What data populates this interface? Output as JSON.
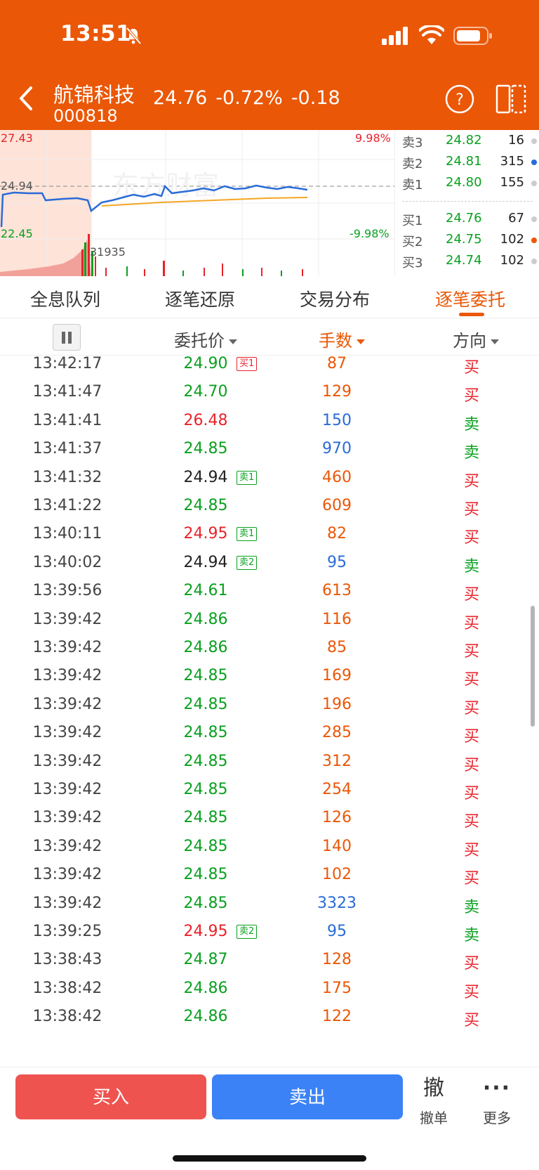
{
  "status": {
    "time": "13:51"
  },
  "stock": {
    "name": "航锦科技",
    "code": "000818",
    "price": "24.76",
    "change_pct": "-0.72%",
    "change": "-0.18"
  },
  "mini_chart": {
    "high_price": "27.43",
    "prev_close": "24.94",
    "low_price": "22.45",
    "high_pct": "9.98%",
    "low_pct": "-9.98%",
    "volume_label": "31935",
    "watermark": "东方财富"
  },
  "order_book": {
    "sell": [
      {
        "level": "卖3",
        "price": "24.82",
        "volume": "16",
        "dot_color": "#cccccc"
      },
      {
        "level": "卖2",
        "price": "24.81",
        "volume": "315",
        "dot_color": "#2a6bd8"
      },
      {
        "level": "卖1",
        "price": "24.80",
        "volume": "155",
        "dot_color": "#cccccc"
      }
    ],
    "buy": [
      {
        "level": "买1",
        "price": "24.76",
        "volume": "67",
        "dot_color": "#cccccc"
      },
      {
        "level": "买2",
        "price": "24.75",
        "volume": "102",
        "dot_color": "#ea5707"
      },
      {
        "level": "买3",
        "price": "24.74",
        "volume": "102",
        "dot_color": "#cccccc"
      }
    ]
  },
  "tabs": [
    {
      "label": "全息队列",
      "active": false
    },
    {
      "label": "逐笔还原",
      "active": false
    },
    {
      "label": "交易分布",
      "active": false
    },
    {
      "label": "逐笔委托",
      "active": true
    }
  ],
  "list_header": {
    "price": "委托价",
    "volume": "手数",
    "direction": "方向"
  },
  "colors": {
    "accent": "#ea5707",
    "up_red": "#e8232b",
    "down_green": "#0aa020",
    "neutral": "#222222",
    "vol_orange": "#ea5707",
    "vol_blue": "#2a6bd8"
  },
  "rows": [
    {
      "time": "13:42:17",
      "price": "24.90",
      "price_color": "green",
      "tag": "买1",
      "tag_color": "red",
      "volume": "87",
      "vol_color": "orange",
      "dir": "买"
    },
    {
      "time": "13:41:47",
      "price": "24.70",
      "price_color": "green",
      "tag": "",
      "tag_color": "",
      "volume": "129",
      "vol_color": "orange",
      "dir": "买"
    },
    {
      "time": "13:41:41",
      "price": "26.48",
      "price_color": "red",
      "tag": "",
      "tag_color": "",
      "volume": "150",
      "vol_color": "blue",
      "dir": "卖"
    },
    {
      "time": "13:41:37",
      "price": "24.85",
      "price_color": "green",
      "tag": "",
      "tag_color": "",
      "volume": "970",
      "vol_color": "blue",
      "dir": "卖"
    },
    {
      "time": "13:41:32",
      "price": "24.94",
      "price_color": "neutral",
      "tag": "卖1",
      "tag_color": "green",
      "volume": "460",
      "vol_color": "orange",
      "dir": "买"
    },
    {
      "time": "13:41:22",
      "price": "24.85",
      "price_color": "green",
      "tag": "",
      "tag_color": "",
      "volume": "609",
      "vol_color": "orange",
      "dir": "买"
    },
    {
      "time": "13:40:11",
      "price": "24.95",
      "price_color": "red",
      "tag": "卖1",
      "tag_color": "green",
      "volume": "82",
      "vol_color": "orange",
      "dir": "买"
    },
    {
      "time": "13:40:02",
      "price": "24.94",
      "price_color": "neutral",
      "tag": "卖2",
      "tag_color": "green",
      "volume": "95",
      "vol_color": "blue",
      "dir": "卖"
    },
    {
      "time": "13:39:56",
      "price": "24.61",
      "price_color": "green",
      "tag": "",
      "tag_color": "",
      "volume": "613",
      "vol_color": "orange",
      "dir": "买"
    },
    {
      "time": "13:39:42",
      "price": "24.86",
      "price_color": "green",
      "tag": "",
      "tag_color": "",
      "volume": "116",
      "vol_color": "orange",
      "dir": "买"
    },
    {
      "time": "13:39:42",
      "price": "24.86",
      "price_color": "green",
      "tag": "",
      "tag_color": "",
      "volume": "85",
      "vol_color": "orange",
      "dir": "买"
    },
    {
      "time": "13:39:42",
      "price": "24.85",
      "price_color": "green",
      "tag": "",
      "tag_color": "",
      "volume": "169",
      "vol_color": "orange",
      "dir": "买"
    },
    {
      "time": "13:39:42",
      "price": "24.85",
      "price_color": "green",
      "tag": "",
      "tag_color": "",
      "volume": "196",
      "vol_color": "orange",
      "dir": "买"
    },
    {
      "time": "13:39:42",
      "price": "24.85",
      "price_color": "green",
      "tag": "",
      "tag_color": "",
      "volume": "285",
      "vol_color": "orange",
      "dir": "买"
    },
    {
      "time": "13:39:42",
      "price": "24.85",
      "price_color": "green",
      "tag": "",
      "tag_color": "",
      "volume": "312",
      "vol_color": "orange",
      "dir": "买"
    },
    {
      "time": "13:39:42",
      "price": "24.85",
      "price_color": "green",
      "tag": "",
      "tag_color": "",
      "volume": "254",
      "vol_color": "orange",
      "dir": "买"
    },
    {
      "time": "13:39:42",
      "price": "24.85",
      "price_color": "green",
      "tag": "",
      "tag_color": "",
      "volume": "126",
      "vol_color": "orange",
      "dir": "买"
    },
    {
      "time": "13:39:42",
      "price": "24.85",
      "price_color": "green",
      "tag": "",
      "tag_color": "",
      "volume": "140",
      "vol_color": "orange",
      "dir": "买"
    },
    {
      "time": "13:39:42",
      "price": "24.85",
      "price_color": "green",
      "tag": "",
      "tag_color": "",
      "volume": "102",
      "vol_color": "orange",
      "dir": "买"
    },
    {
      "time": "13:39:42",
      "price": "24.85",
      "price_color": "green",
      "tag": "",
      "tag_color": "",
      "volume": "3323",
      "vol_color": "blue",
      "dir": "卖"
    },
    {
      "time": "13:39:25",
      "price": "24.95",
      "price_color": "red",
      "tag": "卖2",
      "tag_color": "green",
      "volume": "95",
      "vol_color": "blue",
      "dir": "卖"
    },
    {
      "time": "13:38:43",
      "price": "24.87",
      "price_color": "green",
      "tag": "",
      "tag_color": "",
      "volume": "128",
      "vol_color": "orange",
      "dir": "买"
    },
    {
      "time": "13:38:42",
      "price": "24.86",
      "price_color": "green",
      "tag": "",
      "tag_color": "",
      "volume": "175",
      "vol_color": "orange",
      "dir": "买"
    },
    {
      "time": "13:38:42",
      "price": "24.86",
      "price_color": "green",
      "tag": "",
      "tag_color": "",
      "volume": "122",
      "vol_color": "orange",
      "dir": "买"
    }
  ],
  "bottom_bar": {
    "buy": "买入",
    "sell": "卖出",
    "cancel_icon_char": "撤",
    "cancel_label": "撤单",
    "more_icon_char": "···",
    "more_label": "更多"
  }
}
